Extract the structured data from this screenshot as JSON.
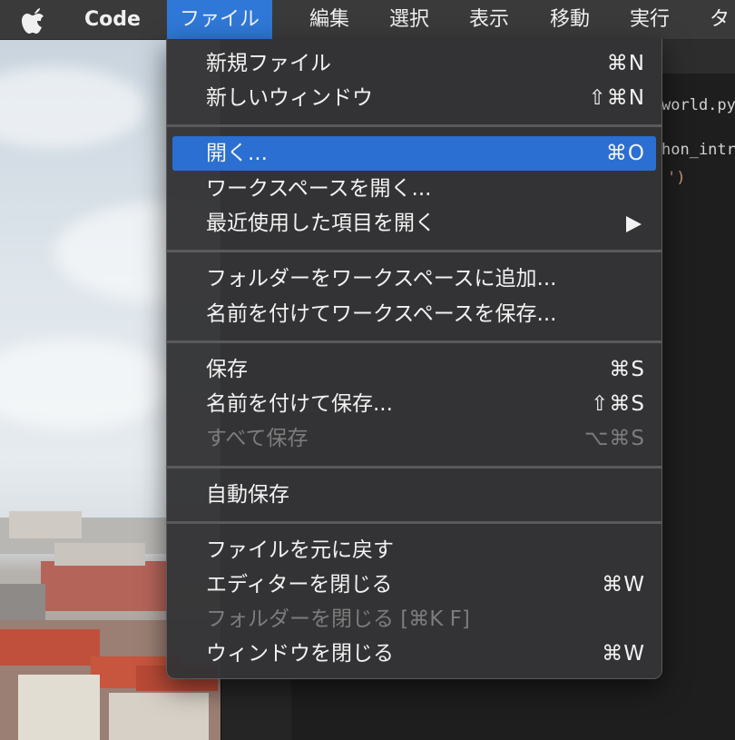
{
  "menubar": {
    "app_name": "Code",
    "items": [
      "ファイル",
      "編集",
      "選択",
      "表示",
      "移動",
      "実行",
      "タ"
    ]
  },
  "editor": {
    "tab_filename": "world.py",
    "code_fragment_1": "hon_intro",
    "code_fragment_2": "')"
  },
  "file_menu": {
    "new_file": {
      "label": "新規ファイル",
      "shortcut": "⌘N"
    },
    "new_window": {
      "label": "新しいウィンドウ",
      "shortcut": "⇧⌘N"
    },
    "open": {
      "label": "開く...",
      "shortcut": "⌘O"
    },
    "open_workspace": {
      "label": "ワークスペースを開く..."
    },
    "open_recent": {
      "label": "最近使用した項目を開く"
    },
    "add_folder": {
      "label": "フォルダーをワークスペースに追加..."
    },
    "save_workspace_as": {
      "label": "名前を付けてワークスペースを保存..."
    },
    "save": {
      "label": "保存",
      "shortcut": "⌘S"
    },
    "save_as": {
      "label": "名前を付けて保存...",
      "shortcut": "⇧⌘S"
    },
    "save_all": {
      "label": "すべて保存",
      "shortcut": "⌥⌘S"
    },
    "auto_save": {
      "label": "自動保存"
    },
    "revert_file": {
      "label": "ファイルを元に戻す"
    },
    "close_editor": {
      "label": "エディターを閉じる",
      "shortcut": "⌘W"
    },
    "close_folder": {
      "label": "フォルダーを閉じる [⌘K F]"
    },
    "close_window": {
      "label": "ウィンドウを閉じる",
      "shortcut": "⌘W"
    }
  },
  "colors": {
    "menubar_bg": "#3a3a3a",
    "menu_highlight": "#2a6fd1",
    "active_menu": "#2f78d7",
    "disabled_text": "#7c7c7c"
  }
}
